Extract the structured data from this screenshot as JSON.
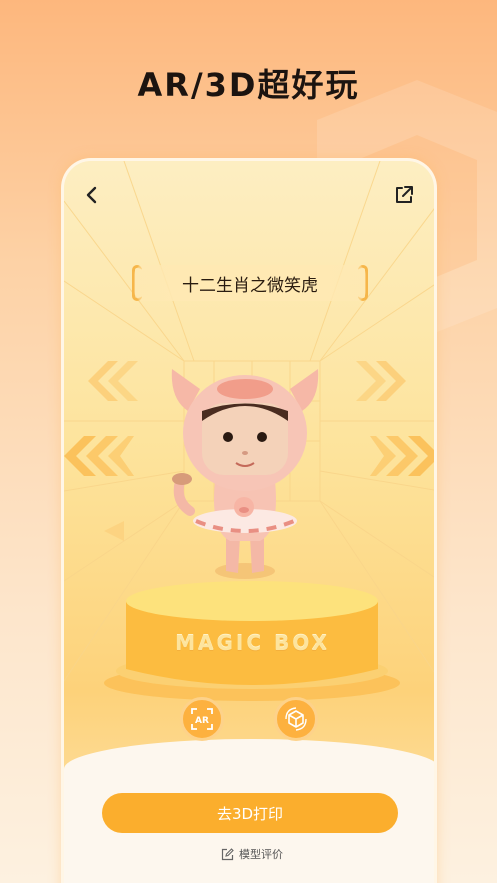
{
  "headline": "AR/3D超好玩",
  "screen": {
    "title": "十二生肖之微笑虎",
    "brand_text": "MAGIC BOX",
    "ar_button_label": "AR",
    "print_button_label": "去3D打印",
    "review_label": "模型评价"
  },
  "icons": {
    "back": "chevron-left-icon",
    "share": "share-icon",
    "ar": "ar-icon",
    "model": "3d-cube-rotate-icon",
    "review": "edit-icon"
  },
  "colors": {
    "accent": "#fbae2d",
    "background_top": "#fdb77d",
    "text_dark": "#1c1410"
  }
}
